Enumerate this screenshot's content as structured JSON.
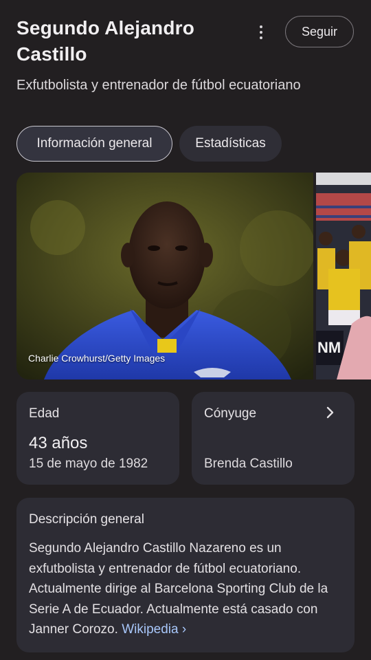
{
  "header": {
    "title": "Segundo Alejandro Castillo",
    "subtitle": "Exfutbolista y entrenador de fútbol ecuatoriano",
    "follow_label": "Seguir"
  },
  "tabs": [
    {
      "label": "Información general",
      "active": true
    },
    {
      "label": "Estadísticas",
      "active": false
    }
  ],
  "images": {
    "credit": "Charlie Crowhurst/Getty Images"
  },
  "facts": {
    "age": {
      "label": "Edad",
      "value": "43 años",
      "detail": "15 de mayo de 1982"
    },
    "spouse": {
      "label": "Cónyuge",
      "value": "Brenda Castillo"
    }
  },
  "description": {
    "heading": "Descripción general",
    "text": "Segundo Alejandro Castillo Nazareno es un exfutbolista y entrenador de fútbol ecuatoriano. Actualmente dirige al Barcelona Sporting Club de la Serie A de Ecuador. Actualmente está casado con Janner Corozo.",
    "source_label": "Wikipedia",
    "source_suffix": "›"
  },
  "colors": {
    "background": "#221f21",
    "card": "#2d2c34",
    "link": "#a8c7fa",
    "jersey_blue": "#2f4fd0",
    "jersey_yellow": "#e8c81a"
  },
  "icons": [
    "more-vert-icon",
    "chevron-right-icon"
  ]
}
